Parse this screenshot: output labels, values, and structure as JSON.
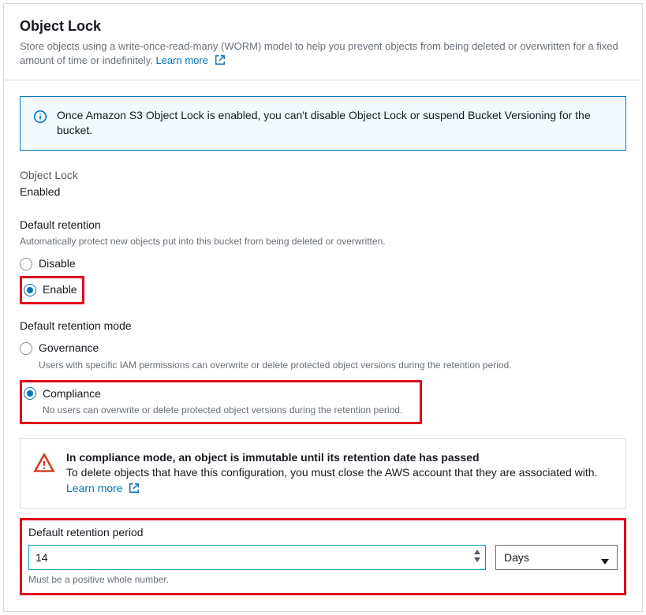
{
  "header": {
    "title": "Object Lock",
    "description": "Store objects using a write-once-read-many (WORM) model to help you prevent objects from being deleted or overwritten for a fixed amount of time or indefinitely.",
    "learn_more": "Learn more"
  },
  "info_box": {
    "text": "Once Amazon S3 Object Lock is enabled, you can't disable Object Lock or suspend Bucket Versioning for the bucket."
  },
  "status": {
    "label": "Object Lock",
    "value": "Enabled"
  },
  "default_retention": {
    "title": "Default retention",
    "hint": "Automatically protect new objects put into this bucket from being deleted or overwritten.",
    "options": {
      "disable": "Disable",
      "enable": "Enable"
    }
  },
  "retention_mode": {
    "title": "Default retention mode",
    "governance": {
      "label": "Governance",
      "desc": "Users with specific IAM permissions can overwrite or delete protected object versions during the retention period."
    },
    "compliance": {
      "label": "Compliance",
      "desc": "No users can overwrite or delete protected object versions during the retention period."
    }
  },
  "warning": {
    "title": "In compliance mode, an object is immutable until its retention date has passed",
    "body": "To delete objects that have this configuration, you must close the AWS account that they are associated with.",
    "learn_more": "Learn more"
  },
  "retention_period": {
    "title": "Default retention period",
    "value": "14",
    "unit": "Days",
    "hint": "Must be a positive whole number."
  }
}
